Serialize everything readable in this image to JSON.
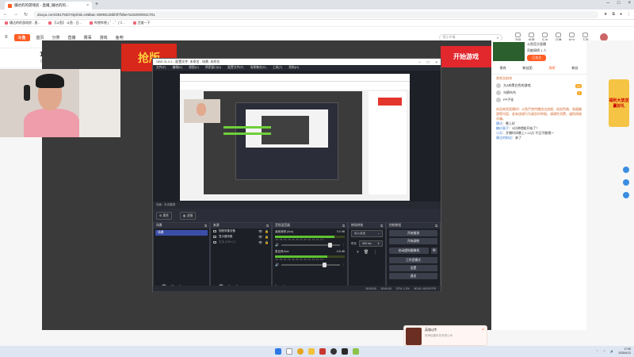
{
  "browser": {
    "tab_title": "珊达的的游戏房 - 直播_珊达的的...",
    "url": "douyu.com/2517933?dyshid=c8d5ac-36093c28bf4f7fd5e7a192000041701",
    "bookmarks": [
      "珊达的的游戏房 - 直...",
      "【斗鱼】 斗鱼 - 日...",
      "哔哩哔哩 ( ゜- ゜)つ...",
      "百度一下"
    ]
  },
  "site": {
    "logo": "斗鱼",
    "nav": [
      "首页",
      "分类",
      "直播",
      "赛事",
      "游戏",
      "鱼吧"
    ],
    "search_placeholder": "提示中毒",
    "header_icons": [
      "消息",
      "收藏",
      "历史",
      "开播",
      "抢宝",
      "下载"
    ],
    "date_num": "12",
    "date_label": "日期",
    "categories": [
      "直播行",
      "页游",
      "鱼吧",
      "旅游",
      "游戏中心",
      "活动",
      "娱乐",
      "竞技",
      "主机",
      "手游",
      "电竞",
      "手游",
      "国内",
      "热门",
      "体育",
      "赛事",
      "福利",
      "商城",
      "斗鱼周边",
      "斗鱼门店",
      "荣誉"
    ],
    "pc_client": "PC客户端"
  },
  "stream": {
    "banner_text": "抢版",
    "game_btn": "开始游戏"
  },
  "right": {
    "anchor_name": "斗鱼官方直播",
    "anchor_sub": "贡献周榜 1 人",
    "follow": "已关注",
    "tabs": [
      "贵宾",
      "粉丝团",
      "周榜",
      "粉丝"
    ],
    "rank_title": "贵宾及前排",
    "rank_rows": [
      {
        "name": "大A的黑白色的游戏",
        "level": "10"
      },
      {
        "name": "乌鸦鸟鸟",
        "level": "2"
      },
      {
        "name": "FP子化",
        "level": ""
      }
    ],
    "notice": "欢迎来到直播间！斗鱼严禁传播违法违规、低俗色情、吸烟酗酒等内容，若有违规行为请及时举报。请理性消费，谨防网络诈骗。",
    "chats": [
      {
        "user": "珊达",
        "text": "晚上好"
      },
      {
        "user": "糖炒栗子",
        "text": "3分钟就能开始了！"
      },
      {
        "user": "小兵",
        "text": "开播时间晚上7-12点 不见不散哦～"
      },
      {
        "user": "珊达的粉丝",
        "text": "来了"
      }
    ],
    "promo": "福利大放送 赢好礼"
  },
  "obs": {
    "title": "OBS 31.0.1 - 配置文件: 未命名 - 场景: 未命名",
    "menu": [
      "文件(F)",
      "编辑(E)",
      "视图(V)",
      "停靠窗口(D)",
      "配置文件(P)",
      "场景集合(S)",
      "工具(T)",
      "帮助(H)"
    ],
    "status_label": "场景 - 未设置源",
    "props_btn": "属性",
    "filters_btn": "滤镜",
    "docks": {
      "scenes": "场景",
      "sources": "来源",
      "mixer": "音频混音器",
      "transitions": "转场特效",
      "controls": "控制按钮"
    },
    "scene_item": "场景",
    "sources": [
      {
        "name": "视频采集设备",
        "dim": false
      },
      {
        "name": "显示器采集",
        "dim": false
      },
      {
        "name": "文本 (GDI+) 2",
        "dim": true
      }
    ],
    "mixer": [
      {
        "name": "桌面音频 (Aux)",
        "db": "0.0 dB",
        "level": 0.85
      },
      {
        "name": "麦克风/Aux",
        "db": "-3.8 dB",
        "level": 0.75
      }
    ],
    "mixer_scale": "-60 -55 -50 -45 -40 -35 -30 -25 -20 -15 -10 -5 0",
    "transition": {
      "type": "淡入淡出",
      "duration_label": "时长",
      "duration": "300 ms"
    },
    "controls": [
      "开始推流",
      "开始录制",
      "启动虚拟摄像机",
      "工作室模式",
      "设置",
      "退出"
    ],
    "bottom": [
      "00:00:00",
      "00:00:00",
      "CPU: 1.2%",
      "60.00 / 60.00 FPS"
    ]
  },
  "ad": {
    "title": "英雄Q传",
    "sub": "珠海拾趣科技有限公司"
  },
  "taskbar": {
    "time": "17:05",
    "date": "2025/4/12"
  }
}
